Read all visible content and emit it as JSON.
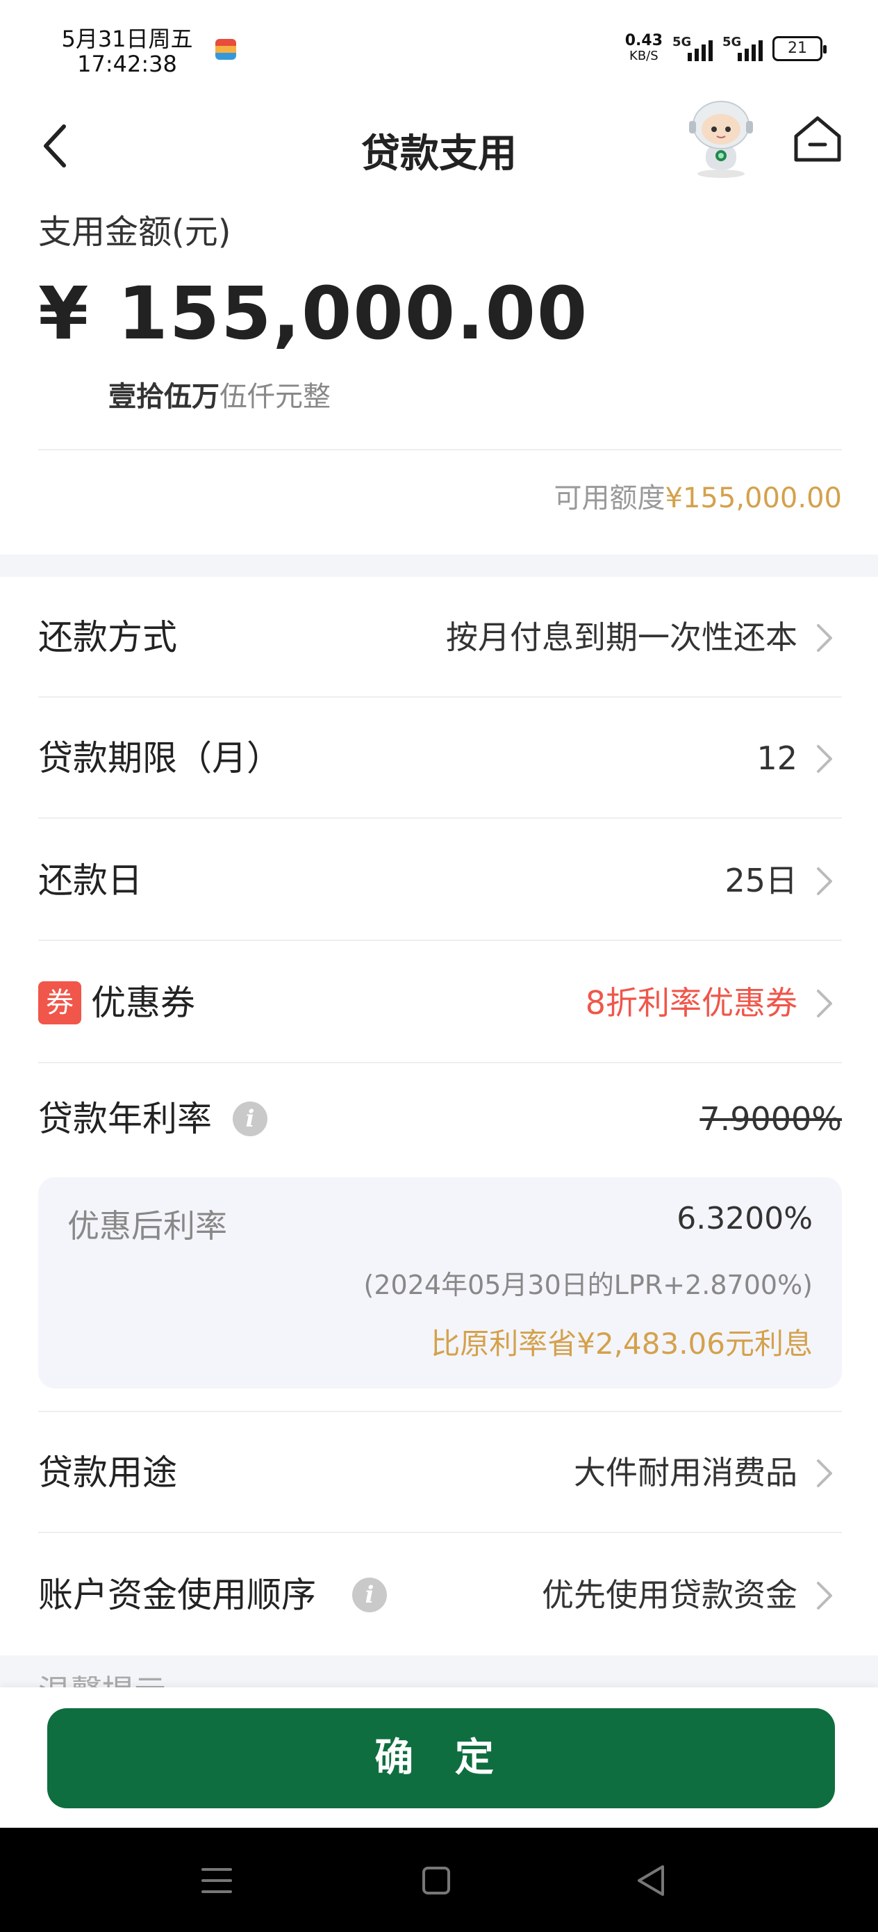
{
  "status_bar": {
    "date": "5月31日周五",
    "time": "17:42:38",
    "net_speed": "0.43",
    "net_unit": "KB/S",
    "sim1": "5G",
    "sim2": "5G",
    "battery": "21"
  },
  "nav": {
    "title": "贷款支用"
  },
  "amount": {
    "label": "支用金额(元)",
    "currency": "¥",
    "value": "155,000.00",
    "cn_strong": "壹拾伍万",
    "cn_light": "伍仟元整",
    "available_label": "可用额度",
    "available_value": "¥155,000.00"
  },
  "rows": {
    "repayment_method": {
      "label": "还款方式",
      "value": "按月付息到期一次性还本"
    },
    "term": {
      "label": "贷款期限（月）",
      "value": "12"
    },
    "repayment_day": {
      "label": "还款日",
      "value": "25日"
    },
    "coupon": {
      "badge": "券",
      "label": "优惠券",
      "value": "8折利率优惠券"
    },
    "rate": {
      "label": "贷款年利率",
      "original": "7.9000%"
    },
    "purpose": {
      "label": "贷款用途",
      "value": "大件耐用消费品"
    },
    "fund_order": {
      "label": "账户资金使用顺序",
      "value": "优先使用贷款资金"
    }
  },
  "rate_box": {
    "after_label": "优惠后利率",
    "after_value": "6.3200%",
    "lpr_note": "(2024年05月30日的LPR+2.8700%)",
    "saved_note": "比原利率省¥2,483.06元利息"
  },
  "tips_title": "温馨提示",
  "confirm_label": "确 定",
  "colors": {
    "primary_green": "#0f6e3f",
    "gold": "#d4a14c",
    "coupon_red": "#f0564a"
  },
  "icons": [
    "back-arrow-icon",
    "robot-assistant-icon",
    "home-icon",
    "chevron-right-icon",
    "info-icon",
    "menu-icon",
    "square-icon",
    "back-triangle-icon"
  ]
}
